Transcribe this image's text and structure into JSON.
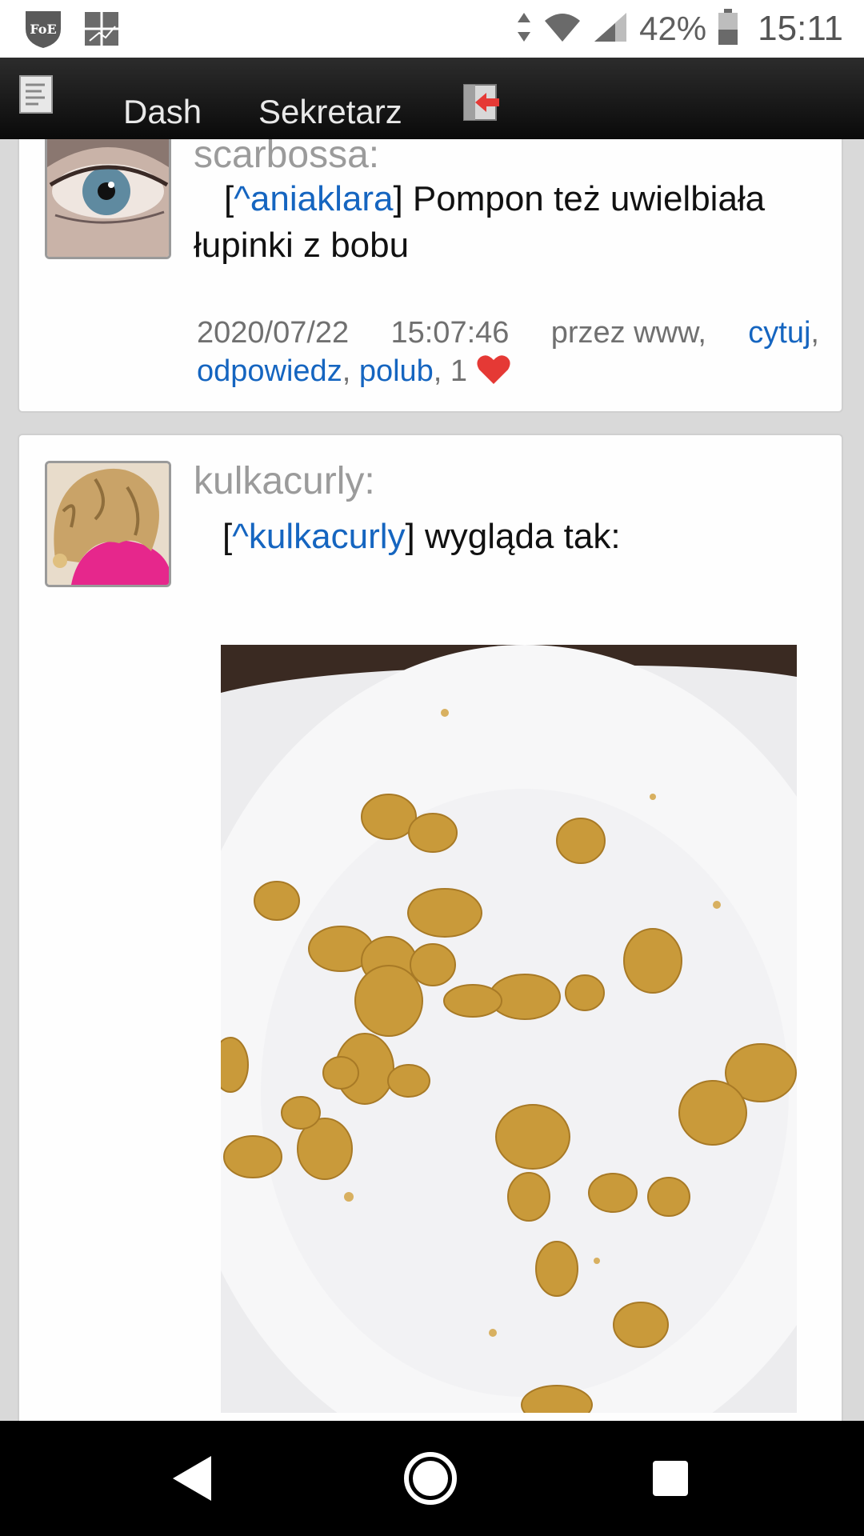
{
  "status_bar": {
    "left_icons": [
      "foe-shield-icon",
      "photo-grid-icon"
    ],
    "battery_percent": "42%",
    "time": "15:11",
    "icons": [
      "data-arrows-icon",
      "wifi-icon",
      "cell-signal-icon",
      "battery-icon"
    ]
  },
  "topbar": {
    "menu_icon": "menu-list-icon",
    "nav_dash": "Dash",
    "nav_sekretarz": "Sekretarz",
    "logout_icon": "logout-icon"
  },
  "posts": [
    {
      "author": "scarbossa:",
      "avatar": "eye-avatar",
      "mention_open": "[",
      "mention": "^aniaklara",
      "mention_close": "]",
      "text": " Pompon też uwielbiała łupinki z bobu",
      "meta": {
        "date": "2020/07/22",
        "time": "15:07:46",
        "via": "przez www,",
        "cytuj": "cytuj",
        "odpowiedz": "odpowiedz",
        "polub": "polub",
        "sep": ",",
        "likes": ", 1"
      }
    },
    {
      "author": "kulkacurly:",
      "avatar": "curly-hair-avatar",
      "mention_open": "[",
      "mention": "^kulkacurly",
      "mention_close": "]",
      "text": " wygląda tak:",
      "image": "bean-husks-on-plate-photo"
    }
  ],
  "colors": {
    "link": "#1565c0",
    "author": "#9b9b9b",
    "heart": "#e53935",
    "topbar": "#151515"
  },
  "navbar": {
    "back_icon": "back-triangle-icon",
    "home_icon": "home-circle-icon",
    "recents_icon": "recents-square-icon"
  }
}
